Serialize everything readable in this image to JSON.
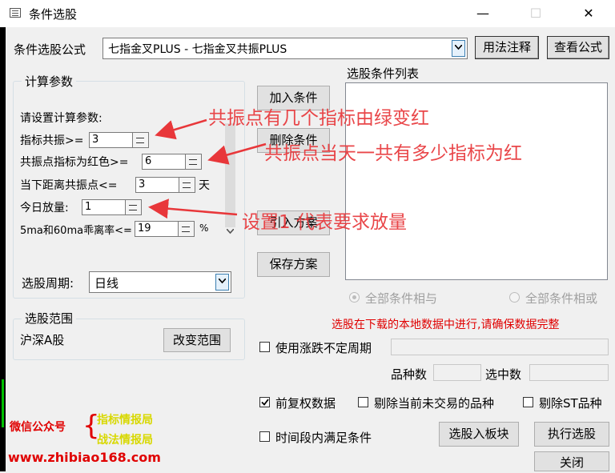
{
  "window": {
    "title": "条件选股",
    "minimize": "—",
    "maximize": "☐",
    "close": "✕"
  },
  "formula": {
    "label": "条件选股公式",
    "value": "七指金叉PLUS - 七指金叉共振PLUS",
    "usage_btn": "用法注释",
    "view_btn": "查看公式"
  },
  "params": {
    "group": "计算参数",
    "prompt": "请设置计算参数:",
    "rows": [
      {
        "label": "指标共振>=",
        "value": "3",
        "unit": ""
      },
      {
        "label": "共振点指标为红色>=",
        "value": "6",
        "unit": ""
      },
      {
        "label": "当下距离共振点<=",
        "value": "3",
        "unit": "天"
      },
      {
        "label": "今日放量:",
        "value": "1",
        "unit": ""
      },
      {
        "label": "5ma和60ma乖离率<=",
        "value": "19",
        "unit": "%"
      }
    ],
    "period_label": "选股周期:",
    "period_value": "日线"
  },
  "actions": {
    "add": "加入条件",
    "delete": "删除条件",
    "import": "引入方案",
    "save": "保存方案"
  },
  "conditions": {
    "label": "选股条件列表",
    "and": "全部条件相与",
    "or": "全部条件相或"
  },
  "range": {
    "group": "选股范围",
    "value": "沪深A股",
    "change_btn": "改变范围"
  },
  "notice": "选股在下载的本地数据中进行,请确保数据完整",
  "options": {
    "variable_period": "使用涨跌不定周期",
    "count_label": "品种数",
    "selected_label": "选中数",
    "forward_adjust": "前复权数据",
    "exclude_untraded": "剔除当前未交易的品种",
    "exclude_st": "剔除ST品种",
    "time_range": "时间段内满足条件",
    "to_block_btn": "选股入板块",
    "execute_btn": "执行选股",
    "close_btn": "关闭"
  },
  "annotations": {
    "a1": "共振点有几个指标由绿变红",
    "a2": "共振点当天一共有多少指标为红",
    "a3": "设置1 代表要求放量"
  },
  "watermark": {
    "prefix": "微信公众号",
    "line1": "指标情报局",
    "line2": "战法情报局",
    "url": "www.zhibiao168.com"
  },
  "colors": {
    "annotation": "#e8373a",
    "notice": "#e00000",
    "watermark_yellow": "#d8d800",
    "watermark_red": "#e00000"
  }
}
